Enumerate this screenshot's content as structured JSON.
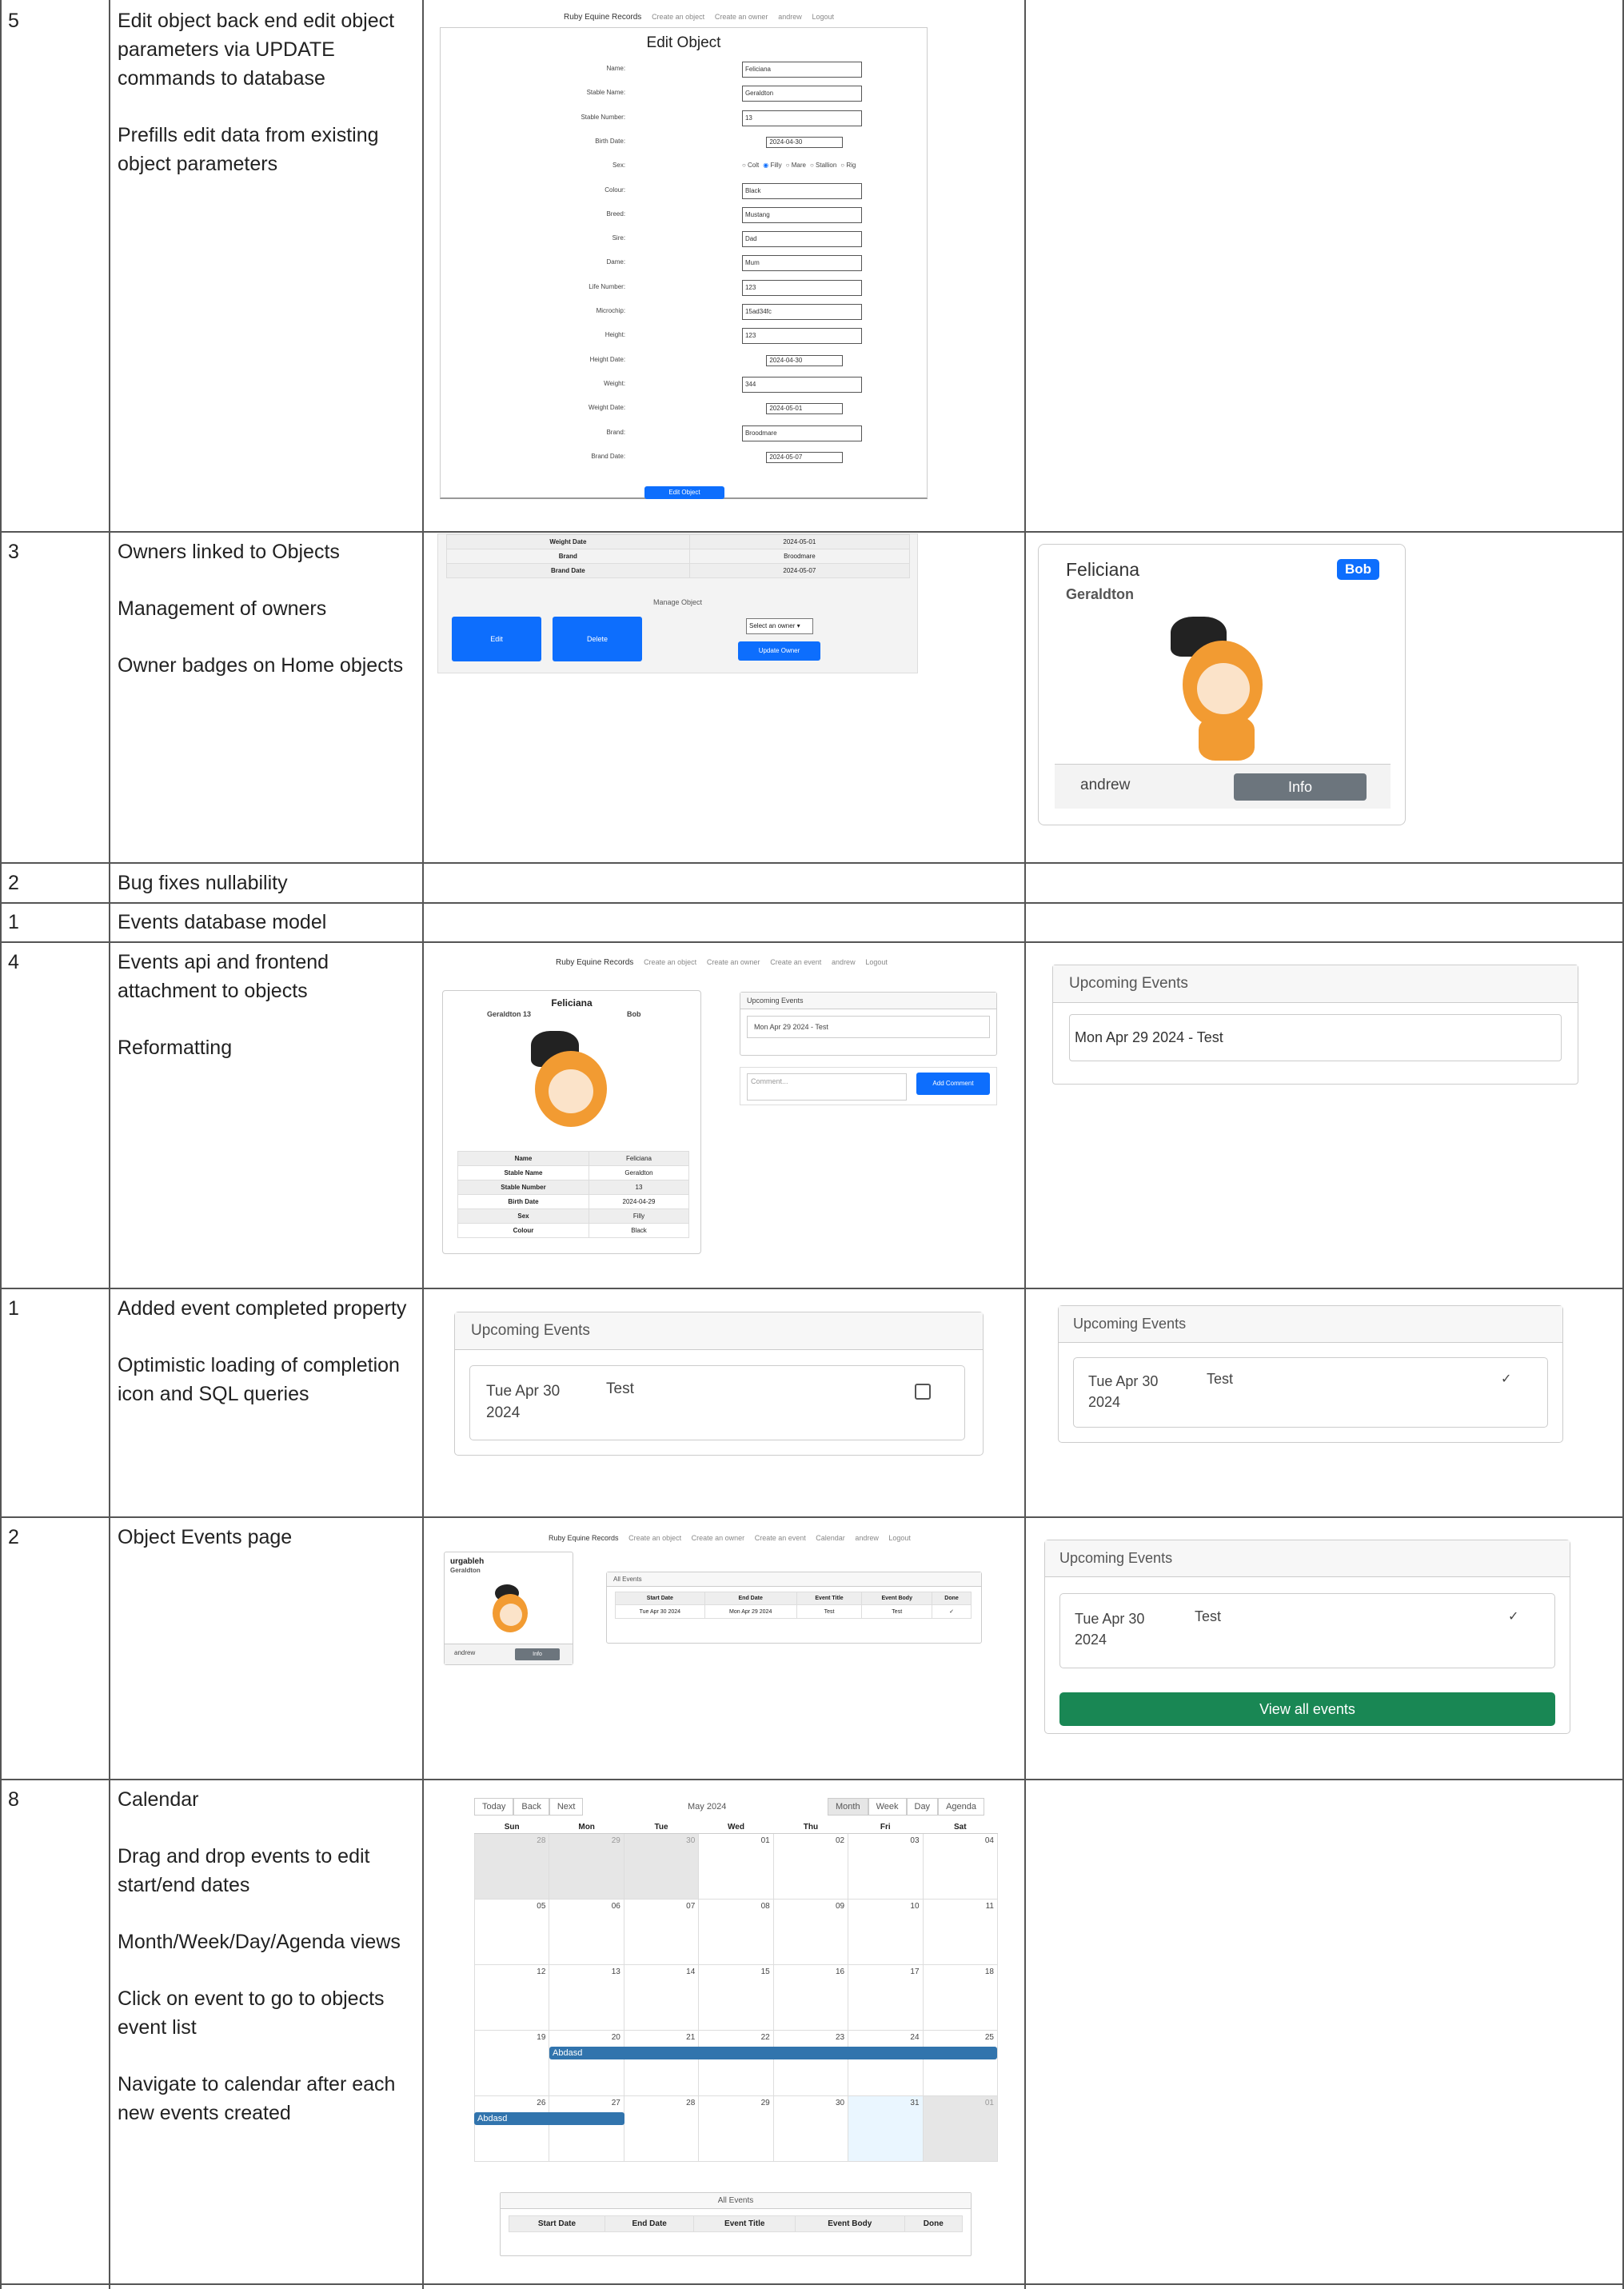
{
  "rows": [
    {
      "points": "5",
      "desc": [
        "Edit object back end edit object parameters via UPDATE commands to database",
        "Prefills edit data from existing object parameters"
      ]
    },
    {
      "points": "3",
      "desc": [
        "Owners linked to Objects",
        "Management of owners",
        "Owner badges on Home objects"
      ]
    },
    {
      "points": "2",
      "desc": [
        "Bug fixes nullability"
      ]
    },
    {
      "points": "1",
      "desc": [
        "Events database model"
      ]
    },
    {
      "points": "4",
      "desc": [
        "Events api and frontend attachment to objects",
        "Reformatting"
      ]
    },
    {
      "points": "1",
      "desc": [
        "Added event completed property",
        "Optimistic loading of completion icon and SQL queries"
      ]
    },
    {
      "points": "2",
      "desc": [
        "Object Events page"
      ]
    },
    {
      "points": "8",
      "desc": [
        "Calendar",
        "Drag and drop events to edit start/end dates",
        "Month/Week/Day/Agenda views",
        "Click on event to go to objects event list",
        "Navigate to calendar after each new events created"
      ]
    }
  ],
  "nav": {
    "brand": "Ruby Equine Records",
    "links": [
      "Create an object",
      "Create an owner",
      "andrew",
      "Logout"
    ],
    "links2": [
      "Create an object",
      "Create an owner",
      "Create an event",
      "andrew",
      "Logout"
    ],
    "links3": [
      "Create an object",
      "Create an owner",
      "Create an event",
      "Calendar",
      "andrew",
      "Logout"
    ]
  },
  "edit_form": {
    "title": "Edit Object",
    "button": "Edit Object",
    "sex_options": [
      "Colt",
      "Filly",
      "Mare",
      "Stallion",
      "Rig"
    ],
    "fields": [
      {
        "label": "Name:",
        "value": "Feliciana"
      },
      {
        "label": "Stable Name:",
        "value": "Geraldton"
      },
      {
        "label": "Stable Number:",
        "value": "13"
      },
      {
        "label": "Birth Date:",
        "value": "2024-04-30",
        "date": true
      },
      {
        "label": "Sex:",
        "value": "",
        "radio": true
      },
      {
        "label": "Colour:",
        "value": "Black"
      },
      {
        "label": "Breed:",
        "value": "Mustang"
      },
      {
        "label": "Sire:",
        "value": "Dad"
      },
      {
        "label": "Dame:",
        "value": "Mum"
      },
      {
        "label": "Life Number:",
        "value": "123"
      },
      {
        "label": "Microchip:",
        "value": "15ad34fc"
      },
      {
        "label": "Height:",
        "value": "123"
      },
      {
        "label": "Height Date:",
        "value": "2024-04-30",
        "date": true
      },
      {
        "label": "Weight:",
        "value": "344"
      },
      {
        "label": "Weight Date:",
        "value": "2024-05-01",
        "date": true
      },
      {
        "label": "Brand:",
        "value": "Broodmare"
      },
      {
        "label": "Brand Date:",
        "value": "2024-05-07",
        "date": true
      }
    ]
  },
  "manage": {
    "rows": [
      [
        "Weight Date",
        "2024-05-01"
      ],
      [
        "Brand",
        "Broodmare"
      ],
      [
        "Brand Date",
        "2024-05-07"
      ]
    ],
    "title": "Manage Object",
    "edit": "Edit",
    "delete": "Delete",
    "select": "Select an owner",
    "update": "Update Owner"
  },
  "owner_card": {
    "name": "Feliciana",
    "stable": "Geraldton",
    "badge": "Bob",
    "owner": "andrew",
    "info": "Info"
  },
  "events_page": {
    "name": "Feliciana",
    "stable": "Geraldton 13",
    "owner": "Bob",
    "upcoming": "Upcoming Events",
    "event": "Mon Apr 29 2024 - Test",
    "comment_ph": "Comment...",
    "add_comment": "Add Comment",
    "rows": [
      [
        "Name",
        "Feliciana"
      ],
      [
        "Stable Name",
        "Geraldton"
      ],
      [
        "Stable Number",
        "13"
      ],
      [
        "Birth Date",
        "2024-04-29"
      ],
      [
        "Sex",
        "Filly"
      ],
      [
        "Colour",
        "Black"
      ]
    ]
  },
  "upcoming_large": {
    "title": "Upcoming Events",
    "event": "Mon Apr 29 2024 - Test"
  },
  "completed": {
    "title": "Upcoming Events",
    "date": "Tue Apr 30 2024",
    "name": "Test",
    "check": "✓"
  },
  "object_events": {
    "name": "urgableh",
    "stable": "Geraldton",
    "owner": "andrew",
    "info": "Info",
    "all": "All Events",
    "headers": [
      "Start Date",
      "End Date",
      "Event Title",
      "Event Body",
      "Done"
    ],
    "row": [
      "Tue Apr 30 2024",
      "Mon Apr 29 2024",
      "Test",
      "Test",
      "✓"
    ],
    "view_all": "View all events"
  },
  "calendar": {
    "today": "Today",
    "back": "Back",
    "next": "Next",
    "month_label": "May 2024",
    "views": [
      "Month",
      "Week",
      "Day",
      "Agenda"
    ],
    "days": [
      "Sun",
      "Mon",
      "Tue",
      "Wed",
      "Thu",
      "Fri",
      "Sat"
    ],
    "weeks": [
      [
        "28",
        "29",
        "30",
        "01",
        "02",
        "03",
        "04"
      ],
      [
        "05",
        "06",
        "07",
        "08",
        "09",
        "10",
        "11"
      ],
      [
        "12",
        "13",
        "14",
        "15",
        "16",
        "17",
        "18"
      ],
      [
        "19",
        "20",
        "21",
        "22",
        "23",
        "24",
        "25"
      ],
      [
        "26",
        "27",
        "28",
        "29",
        "30",
        "31",
        "01"
      ]
    ],
    "event": "Abdasd",
    "all_events": "All Events"
  }
}
